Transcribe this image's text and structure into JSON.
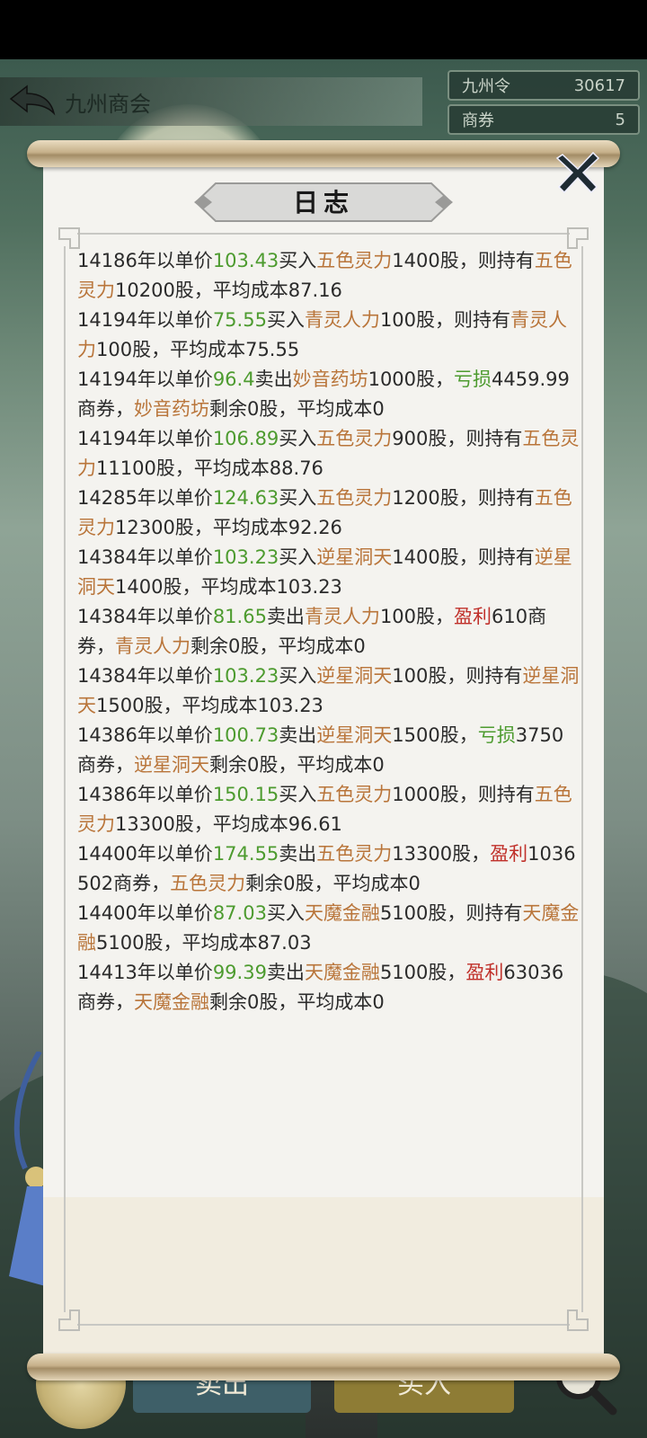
{
  "header": {
    "title": "九州商会"
  },
  "currencies": [
    {
      "name": "九州令",
      "value": "30617"
    },
    {
      "name": "商券",
      "value": "5"
    }
  ],
  "bottom_buttons": {
    "sell": "卖出",
    "buy": "买入"
  },
  "dialog": {
    "title": "日志"
  },
  "log_entries": [
    [
      {
        "t": "14186年以单价"
      },
      {
        "t": "103.43",
        "c": "g"
      },
      {
        "t": "买入"
      },
      {
        "t": "五色灵力",
        "c": "o"
      },
      {
        "t": "1400股，则持有"
      },
      {
        "t": "五色灵力",
        "c": "o"
      },
      {
        "t": "10200股，平均成本87.16"
      }
    ],
    [
      {
        "t": "14194年以单价"
      },
      {
        "t": "75.55",
        "c": "g"
      },
      {
        "t": "买入"
      },
      {
        "t": "青灵人力",
        "c": "o"
      },
      {
        "t": "100股，则持有"
      },
      {
        "t": "青灵人力",
        "c": "o"
      },
      {
        "t": "100股，平均成本75.55"
      }
    ],
    [
      {
        "t": "14194年以单价"
      },
      {
        "t": "96.4",
        "c": "g"
      },
      {
        "t": "卖出"
      },
      {
        "t": "妙音药坊",
        "c": "o"
      },
      {
        "t": "1000股，"
      },
      {
        "t": "亏损",
        "c": "g"
      },
      {
        "t": "4459.99商券，"
      },
      {
        "t": "妙音药坊",
        "c": "o"
      },
      {
        "t": "剩余0股，平均成本0"
      }
    ],
    [
      {
        "t": "14194年以单价"
      },
      {
        "t": "106.89",
        "c": "g"
      },
      {
        "t": "买入"
      },
      {
        "t": "五色灵力",
        "c": "o"
      },
      {
        "t": "900股，则持有"
      },
      {
        "t": "五色灵力",
        "c": "o"
      },
      {
        "t": "11100股，平均成本88.76"
      }
    ],
    [
      {
        "t": "14285年以单价"
      },
      {
        "t": "124.63",
        "c": "g"
      },
      {
        "t": "买入"
      },
      {
        "t": "五色灵力",
        "c": "o"
      },
      {
        "t": "1200股，则持有"
      },
      {
        "t": "五色灵力",
        "c": "o"
      },
      {
        "t": "12300股，平均成本92.26"
      }
    ],
    [
      {
        "t": "14384年以单价"
      },
      {
        "t": "103.23",
        "c": "g"
      },
      {
        "t": "买入"
      },
      {
        "t": "逆星洞天",
        "c": "o"
      },
      {
        "t": "1400股，则持有"
      },
      {
        "t": "逆星洞天",
        "c": "o"
      },
      {
        "t": "1400股，平均成本103.23"
      }
    ],
    [
      {
        "t": "14384年以单价"
      },
      {
        "t": "81.65",
        "c": "g"
      },
      {
        "t": "卖出"
      },
      {
        "t": "青灵人力",
        "c": "o"
      },
      {
        "t": "100股，"
      },
      {
        "t": "盈利",
        "c": "r"
      },
      {
        "t": "610商券，"
      },
      {
        "t": "青灵人力",
        "c": "o"
      },
      {
        "t": "剩余0股，平均成本0"
      }
    ],
    [
      {
        "t": "14384年以单价"
      },
      {
        "t": "103.23",
        "c": "g"
      },
      {
        "t": "买入"
      },
      {
        "t": "逆星洞天",
        "c": "o"
      },
      {
        "t": "100股，则持有"
      },
      {
        "t": "逆星洞天",
        "c": "o"
      },
      {
        "t": "1500股，平均成本103.23"
      }
    ],
    [
      {
        "t": "14386年以单价"
      },
      {
        "t": "100.73",
        "c": "g"
      },
      {
        "t": "卖出"
      },
      {
        "t": "逆星洞天",
        "c": "o"
      },
      {
        "t": "1500股，"
      },
      {
        "t": "亏损",
        "c": "g"
      },
      {
        "t": "3750商券，"
      },
      {
        "t": "逆星洞天",
        "c": "o"
      },
      {
        "t": "剩余0股，平均成本0"
      }
    ],
    [
      {
        "t": "14386年以单价"
      },
      {
        "t": "150.15",
        "c": "g"
      },
      {
        "t": "买入"
      },
      {
        "t": "五色灵力",
        "c": "o"
      },
      {
        "t": "1000股，则持有"
      },
      {
        "t": "五色灵力",
        "c": "o"
      },
      {
        "t": "13300股，平均成本96.61"
      }
    ],
    [
      {
        "t": "14400年以单价"
      },
      {
        "t": "174.55",
        "c": "g"
      },
      {
        "t": "卖出"
      },
      {
        "t": "五色灵力",
        "c": "o"
      },
      {
        "t": "13300股，"
      },
      {
        "t": "盈利",
        "c": "r"
      },
      {
        "t": "1036502商券，"
      },
      {
        "t": "五色灵力",
        "c": "o"
      },
      {
        "t": "剩余0股，平均成本0"
      }
    ],
    [
      {
        "t": "14400年以单价"
      },
      {
        "t": "87.03",
        "c": "g"
      },
      {
        "t": "买入"
      },
      {
        "t": "天魔金融",
        "c": "o"
      },
      {
        "t": "5100股，则持有"
      },
      {
        "t": "天魔金融",
        "c": "o"
      },
      {
        "t": "5100股，平均成本87.03"
      }
    ],
    [
      {
        "t": "14413年以单价"
      },
      {
        "t": "99.39",
        "c": "g"
      },
      {
        "t": "卖出"
      },
      {
        "t": "天魔金融",
        "c": "o"
      },
      {
        "t": "5100股，"
      },
      {
        "t": "盈利",
        "c": "r"
      },
      {
        "t": "63036商券，"
      },
      {
        "t": "天魔金融",
        "c": "o"
      },
      {
        "t": "剩余0股，平均成本0"
      }
    ]
  ]
}
